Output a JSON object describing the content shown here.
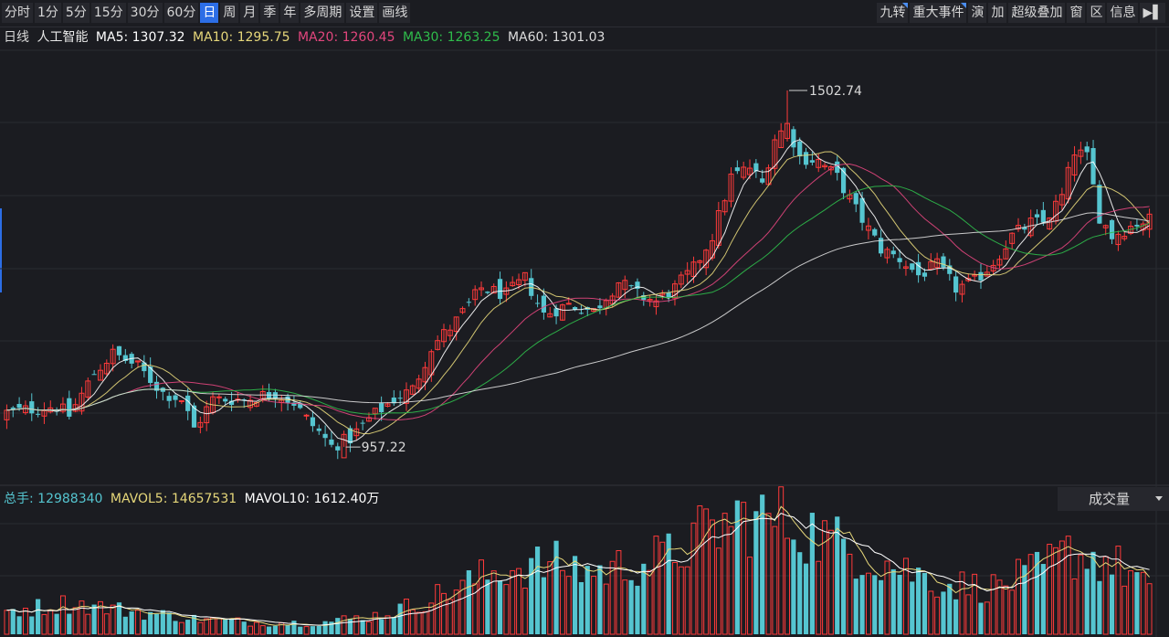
{
  "toolbar": {
    "periods": [
      {
        "label": "分时",
        "active": false
      },
      {
        "label": "1分",
        "active": false
      },
      {
        "label": "5分",
        "active": false
      },
      {
        "label": "15分",
        "active": false
      },
      {
        "label": "30分",
        "active": false
      },
      {
        "label": "60分",
        "active": false
      },
      {
        "label": "日",
        "active": true
      },
      {
        "label": "周",
        "active": false
      },
      {
        "label": "月",
        "active": false
      },
      {
        "label": "季",
        "active": false
      },
      {
        "label": "年",
        "active": false
      },
      {
        "label": "多周期",
        "active": false
      },
      {
        "label": "设置",
        "active": false
      },
      {
        "label": "画线",
        "active": false
      }
    ],
    "tools": [
      {
        "label": "九转",
        "flag": true
      },
      {
        "label": "重大事件",
        "flag": true
      },
      {
        "label": "演",
        "flag": false
      },
      {
        "label": "加",
        "flag": false
      },
      {
        "label": "超级叠加",
        "flag": false
      },
      {
        "label": "窗",
        "flag": false
      },
      {
        "label": "区",
        "flag": false
      },
      {
        "label": "信息",
        "flag": false
      },
      {
        "label": "▶▌",
        "flag": false
      }
    ]
  },
  "header": {
    "period_label": "日线",
    "index_name": "人工智能",
    "ma5": "MA5: 1307.32",
    "ma10": "MA10: 1295.75",
    "ma20": "MA20: 1260.45",
    "ma30": "MA30: 1263.25",
    "ma60": "MA60: 1301.03"
  },
  "volume_header": {
    "total": "总手: 12988340",
    "mavol5": "MAVOL5: 14657531",
    "mavol10": "MAVOL10: 1612.40万",
    "selector": "成交量"
  },
  "colors": {
    "up": "#ff3a3a",
    "down": "#55c5d0",
    "ma5": "#ffffff",
    "ma10": "#e6d77a",
    "ma20": "#e2467d",
    "ma30": "#2fbc4b",
    "ma60": "#dddddd",
    "accent": "#2c6ee6"
  },
  "chart_data": {
    "type": "candlestick",
    "price_range": [
      900,
      1560
    ],
    "max_label": "1502.74",
    "min_label": "957.22",
    "close_path": [
      [
        0,
        1010
      ],
      [
        8,
        1020
      ],
      [
        10,
        1005
      ],
      [
        14,
        1070
      ],
      [
        17,
        1100
      ],
      [
        21,
        1080
      ],
      [
        25,
        1040
      ],
      [
        28,
        1030
      ],
      [
        30,
        985
      ],
      [
        33,
        1030
      ],
      [
        38,
        1030
      ],
      [
        43,
        1040
      ],
      [
        46,
        1025
      ],
      [
        48,
        1000
      ],
      [
        50,
        980
      ],
      [
        52,
        958
      ],
      [
        55,
        970
      ],
      [
        58,
        1000
      ],
      [
        62,
        1030
      ],
      [
        65,
        1045
      ],
      [
        68,
        1110
      ],
      [
        72,
        1150
      ],
      [
        76,
        1200
      ],
      [
        80,
        1190
      ],
      [
        83,
        1215
      ],
      [
        86,
        1160
      ],
      [
        90,
        1175
      ],
      [
        94,
        1165
      ],
      [
        98,
        1210
      ],
      [
        101,
        1190
      ],
      [
        104,
        1180
      ],
      [
        107,
        1200
      ],
      [
        110,
        1230
      ],
      [
        113,
        1280
      ],
      [
        116,
        1370
      ],
      [
        119,
        1385
      ],
      [
        121,
        1360
      ],
      [
        123,
        1430
      ],
      [
        125,
        1450
      ],
      [
        127,
        1400
      ],
      [
        130,
        1395
      ],
      [
        133,
        1370
      ],
      [
        136,
        1320
      ],
      [
        138,
        1290
      ],
      [
        140,
        1260
      ],
      [
        143,
        1245
      ],
      [
        146,
        1220
      ],
      [
        149,
        1235
      ],
      [
        152,
        1200
      ],
      [
        155,
        1210
      ],
      [
        158,
        1240
      ],
      [
        161,
        1280
      ],
      [
        164,
        1300
      ],
      [
        166,
        1300
      ],
      [
        169,
        1340
      ],
      [
        171,
        1410
      ],
      [
        173,
        1400
      ],
      [
        175,
        1310
      ],
      [
        177,
        1280
      ],
      [
        179,
        1290
      ],
      [
        181,
        1300
      ],
      [
        183,
        1305
      ]
    ],
    "candle_count": 184,
    "volume_range": [
      0,
      31000000
    ],
    "volume_last": 12988340,
    "volume_path": [
      [
        0,
        6
      ],
      [
        10,
        8
      ],
      [
        20,
        6
      ],
      [
        30,
        4
      ],
      [
        40,
        3
      ],
      [
        50,
        3
      ],
      [
        60,
        5
      ],
      [
        66,
        8
      ],
      [
        72,
        12
      ],
      [
        80,
        17
      ],
      [
        88,
        18
      ],
      [
        95,
        16
      ],
      [
        100,
        18
      ],
      [
        106,
        20
      ],
      [
        112,
        26
      ],
      [
        118,
        30
      ],
      [
        125,
        29
      ],
      [
        132,
        24
      ],
      [
        140,
        19
      ],
      [
        150,
        13
      ],
      [
        158,
        12
      ],
      [
        165,
        16
      ],
      [
        170,
        21
      ],
      [
        176,
        19
      ],
      [
        183,
        13
      ]
    ]
  }
}
